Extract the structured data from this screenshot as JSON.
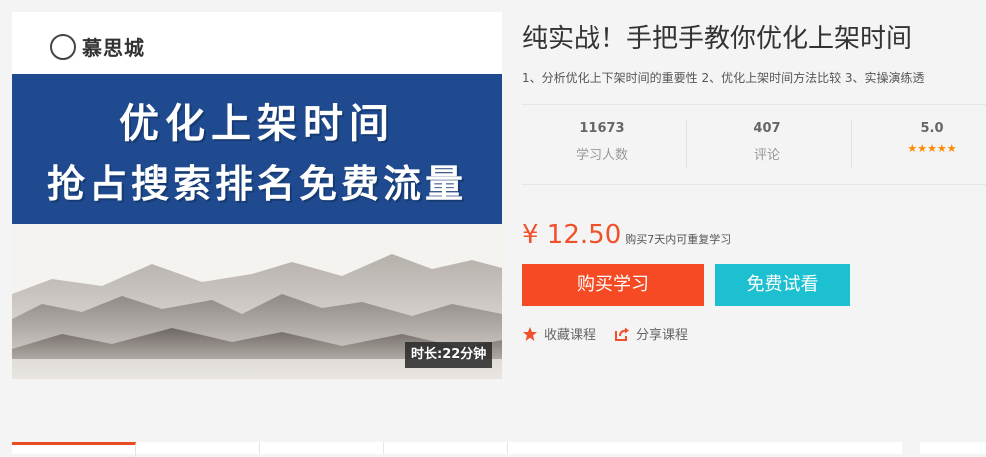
{
  "cover": {
    "logo_seal": "",
    "logo_text": "慕思城",
    "headline_1": "优化上架时间",
    "headline_2": "抢占搜索排名免费流量",
    "duration": "时长:22分钟"
  },
  "course": {
    "title": "纯实战！手把手教你优化上架时间",
    "description": "1、分析优化上下架时间的重要性 2、优化上架时间方法比较 3、实操演练透"
  },
  "stats": [
    {
      "value": "11673",
      "label": "学习人数"
    },
    {
      "value": "407",
      "label": "评论"
    },
    {
      "value": "5.0",
      "label": "",
      "stars": 5
    }
  ],
  "pricing": {
    "price": "¥ 12.50",
    "note": "购买7天内可重复学习"
  },
  "buttons": {
    "buy": "购买学习",
    "trial": "免费试看"
  },
  "actions": {
    "favorite": "收藏课程",
    "share": "分享课程"
  },
  "colors": {
    "accent": "#f54a23",
    "trial": "#1cc0d0",
    "banner": "#1f4a8f",
    "star": "#ff8a00"
  }
}
